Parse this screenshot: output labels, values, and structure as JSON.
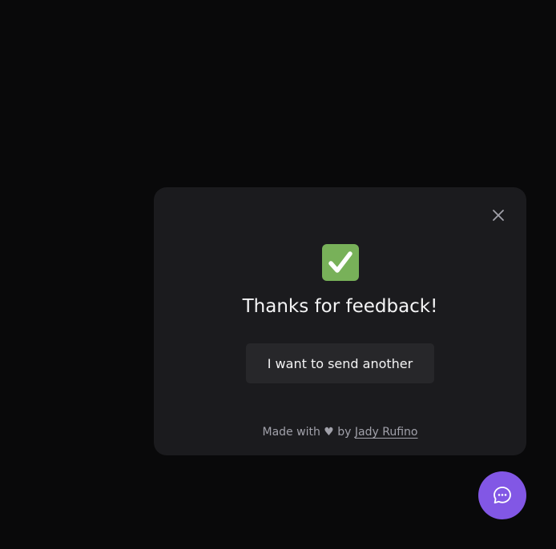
{
  "colors": {
    "page_background": "#09090a",
    "card_background": "#1b1b1e",
    "button_background": "#27272a",
    "brand": "#8257e5",
    "success": "#78b159"
  },
  "widget": {
    "close_icon": "close-icon",
    "success_icon": "check-mark-button-icon",
    "title": "Thanks for feedback!",
    "send_another_label": "I want to send another",
    "footer": {
      "prefix": "Made with",
      "heart": "♥",
      "by": "by",
      "author": "Jady Rufino"
    }
  },
  "launcher": {
    "icon": "chat-bubble-icon"
  }
}
